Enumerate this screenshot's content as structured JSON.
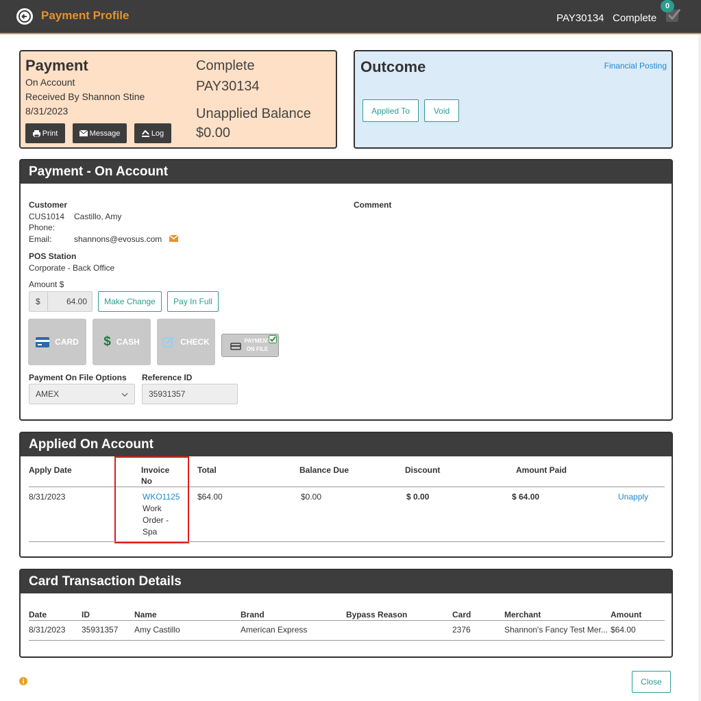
{
  "header": {
    "title": "Payment Profile",
    "payment_id": "PAY30134",
    "status": "Complete",
    "task_count": "0"
  },
  "payment_card": {
    "heading": "Payment",
    "type": "On Account",
    "received_by": "Received By Shannon Stine",
    "date": "8/31/2023",
    "status": "Complete",
    "payment_id": "PAY30134",
    "unapplied_label": "Unapplied Balance",
    "unapplied_value": "$0.00",
    "buttons": {
      "print": "Print",
      "message": "Message",
      "log": "Log"
    }
  },
  "outcome_card": {
    "heading": "Outcome",
    "financial_posting": "Financial Posting",
    "applied_to": "Applied To",
    "void": "Void"
  },
  "payment_panel": {
    "title": "Payment - On Account",
    "customer_label": "Customer",
    "customer_id": "CUS1014",
    "customer_name": "Castillo, Amy",
    "phone_label": "Phone:",
    "email_label": "Email:",
    "email": "shannons@evosus.com",
    "comment_label": "Comment",
    "pos_label": "POS Station",
    "pos_value": "Corporate - Back Office",
    "amount_label": "Amount $",
    "currency_symbol": "$",
    "amount_value": "64.00",
    "make_change": "Make Change",
    "pay_in_full": "Pay In Full",
    "methods": {
      "card": "CARD",
      "cash": "CASH",
      "check": "CHECK",
      "pof_line1": "PAYMENT",
      "pof_line2": "ON FILE"
    },
    "pof_options_label": "Payment On File Options",
    "pof_selected": "AMEX",
    "reference_label": "Reference ID",
    "reference_value": "35931357"
  },
  "applied_panel": {
    "title": "Applied On Account",
    "columns": {
      "apply_date": "Apply Date",
      "invoice_1": "Invoice",
      "invoice_2": "No",
      "total": "Total",
      "balance_due": "Balance Due",
      "discount": "Discount",
      "amount_paid": "Amount Paid"
    },
    "row": {
      "apply_date": "8/31/2023",
      "invoice_no": "WKO1125",
      "invoice_desc_1": "Work",
      "invoice_desc_2": "Order -",
      "invoice_desc_3": "Spa",
      "total": "$64.00",
      "balance_due": "$0.00",
      "discount": "$ 0.00",
      "amount_paid": "$ 64.00",
      "action": "Unapply"
    }
  },
  "card_panel": {
    "title": "Card Transaction Details",
    "columns": {
      "date": "Date",
      "id": "ID",
      "name": "Name",
      "brand": "Brand",
      "bypass": "Bypass Reason",
      "card": "Card",
      "merchant": "Merchant",
      "amount": "Amount"
    },
    "row": {
      "date": "8/31/2023",
      "id": "35931357",
      "name": "Amy Castillo",
      "brand": "American Express",
      "bypass": "",
      "card": "2376",
      "merchant": "Shannon's Fancy Test Mer...",
      "amount": "$64.00"
    }
  },
  "footer": {
    "close": "Close"
  },
  "colors": {
    "accent_orange": "#e8912c",
    "teal": "#2a9d8f",
    "link_blue": "#1e88d0",
    "highlight_red": "#e01b1b"
  }
}
